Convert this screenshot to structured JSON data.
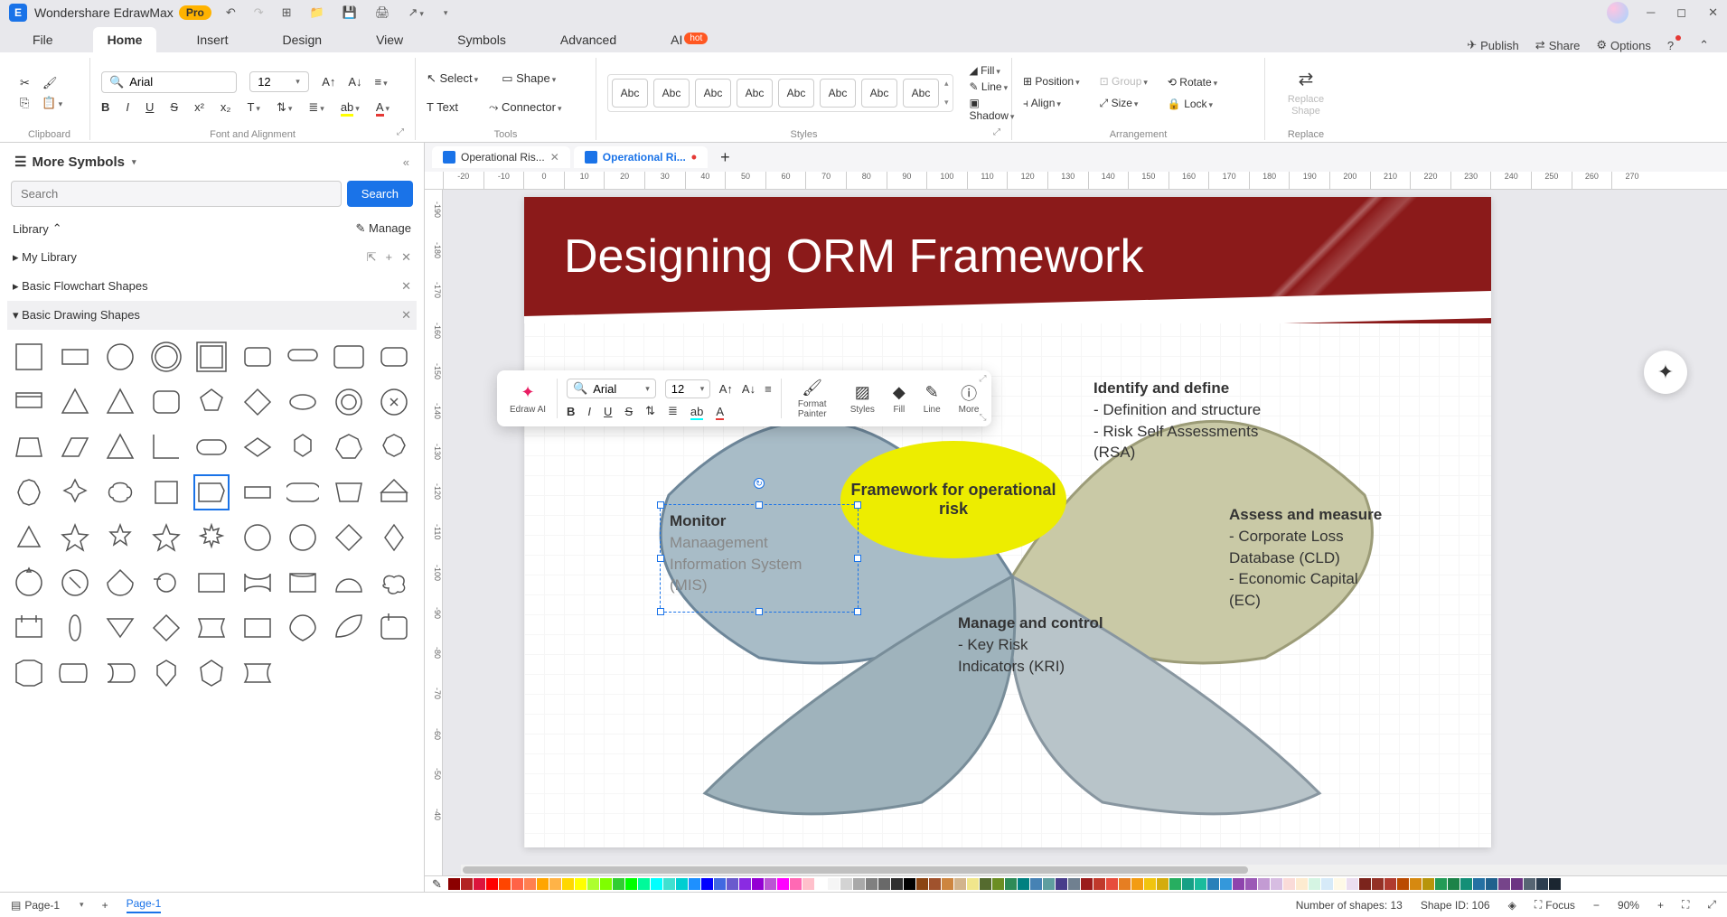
{
  "app": {
    "name": "Wondershare EdrawMax",
    "badge": "Pro"
  },
  "menu": {
    "tabs": [
      "File",
      "Home",
      "Insert",
      "Design",
      "View",
      "Symbols",
      "Advanced",
      "AI"
    ],
    "active": "Home",
    "hot_badge": "hot",
    "right": {
      "publish": "Publish",
      "share": "Share",
      "options": "Options"
    }
  },
  "ribbon": {
    "clipboard_label": "Clipboard",
    "font_label": "Font and Alignment",
    "font_name": "Arial",
    "font_size": "12",
    "tools_label": "Tools",
    "select_label": "Select",
    "text_label": "Text",
    "shape_label": "Shape",
    "connector_label": "Connector",
    "styles_label": "Styles",
    "style_sample": "Abc",
    "fill": "Fill",
    "line": "Line",
    "shadow": "Shadow",
    "arrangement_label": "Arrangement",
    "position": "Position",
    "align": "Align",
    "group": "Group",
    "size": "Size",
    "rotate": "Rotate",
    "lock": "Lock",
    "replace_label": "Replace",
    "replace_shape": "Replace Shape"
  },
  "left": {
    "title": "More Symbols",
    "search_placeholder": "Search",
    "search_btn": "Search",
    "library": "Library",
    "manage": "Manage",
    "my_library": "My Library",
    "cat_flowchart": "Basic Flowchart Shapes",
    "cat_drawing": "Basic Drawing Shapes"
  },
  "doctabs": {
    "tabs": [
      {
        "name": "Operational Ris...",
        "active": false,
        "dirty": false
      },
      {
        "name": "Operational Ri...",
        "active": true,
        "dirty": true
      }
    ]
  },
  "ruler_h": [
    "-20",
    "-10",
    "0",
    "10",
    "20",
    "30",
    "40",
    "50",
    "60",
    "70",
    "80",
    "90",
    "100",
    "110",
    "120",
    "130",
    "140",
    "150",
    "160",
    "170",
    "180",
    "190",
    "200",
    "210",
    "220",
    "230",
    "240",
    "250",
    "260",
    "270"
  ],
  "ruler_v": [
    "-190",
    "-180",
    "-170",
    "-160",
    "-150",
    "-140",
    "-130",
    "-120",
    "-110",
    "-100",
    "-90",
    "-80",
    "-70",
    "-60",
    "-50",
    "-40"
  ],
  "slide": {
    "title": "Designing ORM Framework",
    "center": "Framework for operational risk",
    "identify_hd": "Identify and define",
    "identify_b1": "- Definition and structure",
    "identify_b2": "- Risk Self Assessments",
    "identify_b3": "  (RSA)",
    "assess_hd": "Assess and measure",
    "assess_b1": "- Corporate Loss",
    "assess_b2": "  Database (CLD)",
    "assess_b3": "- Economic Capital",
    "assess_b4": "  (EC)",
    "manage_hd": "Manage and control",
    "manage_b1": "- Key Risk",
    "manage_b2": "  Indicators (KRI)",
    "monitor_hd": "Monitor",
    "monitor_b1": "Manaagement",
    "monitor_b2": "  Information System",
    "monitor_b3": "  (MIS)"
  },
  "floatbar": {
    "ai": "Edraw AI",
    "font": "Arial",
    "size": "12",
    "format_painter": "Format Painter",
    "styles": "Styles",
    "fill": "Fill",
    "line": "Line",
    "more": "More"
  },
  "status": {
    "page_label": "Page-1",
    "page_tab": "Page-1",
    "shapes": "Number of shapes: 13",
    "shapeid": "Shape ID: 106",
    "focus": "Focus",
    "zoom": "90%"
  },
  "colors": [
    "#8b0000",
    "#b22222",
    "#dc143c",
    "#ff0000",
    "#ff4500",
    "#ff6347",
    "#ff7f50",
    "#ffa500",
    "#ffb347",
    "#ffd700",
    "#ffff00",
    "#adff2f",
    "#7fff00",
    "#32cd32",
    "#00ff00",
    "#00fa9a",
    "#00ffff",
    "#40e0d0",
    "#00ced1",
    "#1e90ff",
    "#0000ff",
    "#4169e1",
    "#6a5acd",
    "#8a2be2",
    "#9400d3",
    "#ba55d3",
    "#ff00ff",
    "#ff69b4",
    "#ffc0cb",
    "#ffffff",
    "#f5f5f5",
    "#d3d3d3",
    "#a9a9a9",
    "#808080",
    "#696969",
    "#2f2f2f",
    "#000000",
    "#8b4513",
    "#a0522d",
    "#cd853f",
    "#d2b48c",
    "#f0e68c",
    "#556b2f",
    "#6b8e23",
    "#2e8b57",
    "#008080",
    "#4682b4",
    "#5f9ea0",
    "#483d8b",
    "#708090",
    "#9b1c1c",
    "#c0392b",
    "#e74c3c",
    "#e67e22",
    "#f39c12",
    "#f1c40f",
    "#d4ac0d",
    "#27ae60",
    "#16a085",
    "#1abc9c",
    "#2980b9",
    "#3498db",
    "#8e44ad",
    "#9b59b6",
    "#c39bd3",
    "#d7bde2",
    "#fadbd8",
    "#fdebd0",
    "#d5f5e3",
    "#d6eaf8",
    "#fef9e7",
    "#ebdef0",
    "#7b241c",
    "#943126",
    "#b03a2e",
    "#ba4a00",
    "#d68910",
    "#b7950b",
    "#239b56",
    "#1d8348",
    "#148f77",
    "#2471a3",
    "#1f618d",
    "#76448a",
    "#6c3483",
    "#566573",
    "#2c3e50",
    "#1b2631"
  ]
}
